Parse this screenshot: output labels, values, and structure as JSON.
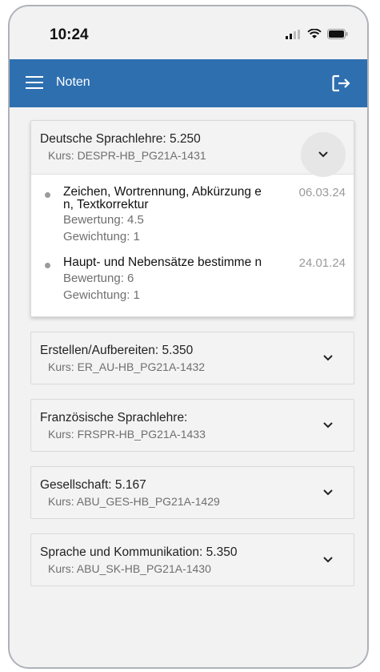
{
  "status": {
    "time": "10:24"
  },
  "appbar": {
    "title": "Noten"
  },
  "courses": [
    {
      "title": "Deutsche Sprachlehre: 5.250",
      "course": "Kurs: DESPR-HB_PG21A-1431",
      "expanded": true,
      "grades": [
        {
          "title": "Zeichen, Wortrennung, Abkürzung en, Textkorrektur",
          "date": "06.03.24",
          "rating": "Bewertung: 4.5",
          "weight": "Gewichtung: 1"
        },
        {
          "title": "Haupt- und Nebensätze bestimme n",
          "date": "24.01.24",
          "rating": "Bewertung: 6",
          "weight": "Gewichtung: 1"
        }
      ]
    },
    {
      "title": "Erstellen/Aufbereiten: 5.350",
      "course": "Kurs: ER_AU-HB_PG21A-1432"
    },
    {
      "title": "Französische Sprachlehre:",
      "course": "Kurs: FRSPR-HB_PG21A-1433"
    },
    {
      "title": "Gesellschaft: 5.167",
      "course": "Kurs: ABU_GES-HB_PG21A-1429"
    },
    {
      "title": "Sprache und Kommunikation: 5.350",
      "course": "Kurs: ABU_SK-HB_PG21A-1430"
    }
  ],
  "colors": {
    "appbar": "#2e6fb0",
    "background": "#f2f2f2"
  }
}
